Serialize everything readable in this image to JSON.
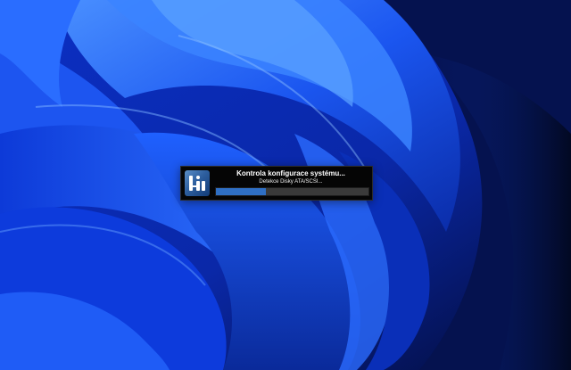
{
  "desktop": {
    "wallpaper_icon": "windows-11-bloom-wallpaper",
    "colors": {
      "wallpaper_dark": "#030b3a",
      "wallpaper_mid": "#0b35c8",
      "wallpaper_light": "#3f8cff"
    }
  },
  "splash": {
    "icon": "app-logo-icon",
    "title": "Kontrola konfigurace systému...",
    "status": "Detekce Disky ATA/SCSI...",
    "progress_fraction": 0.33,
    "colors": {
      "background": "#050505",
      "progress_track": "#3a3a3a",
      "progress_fill": "#2f6fc4"
    }
  }
}
